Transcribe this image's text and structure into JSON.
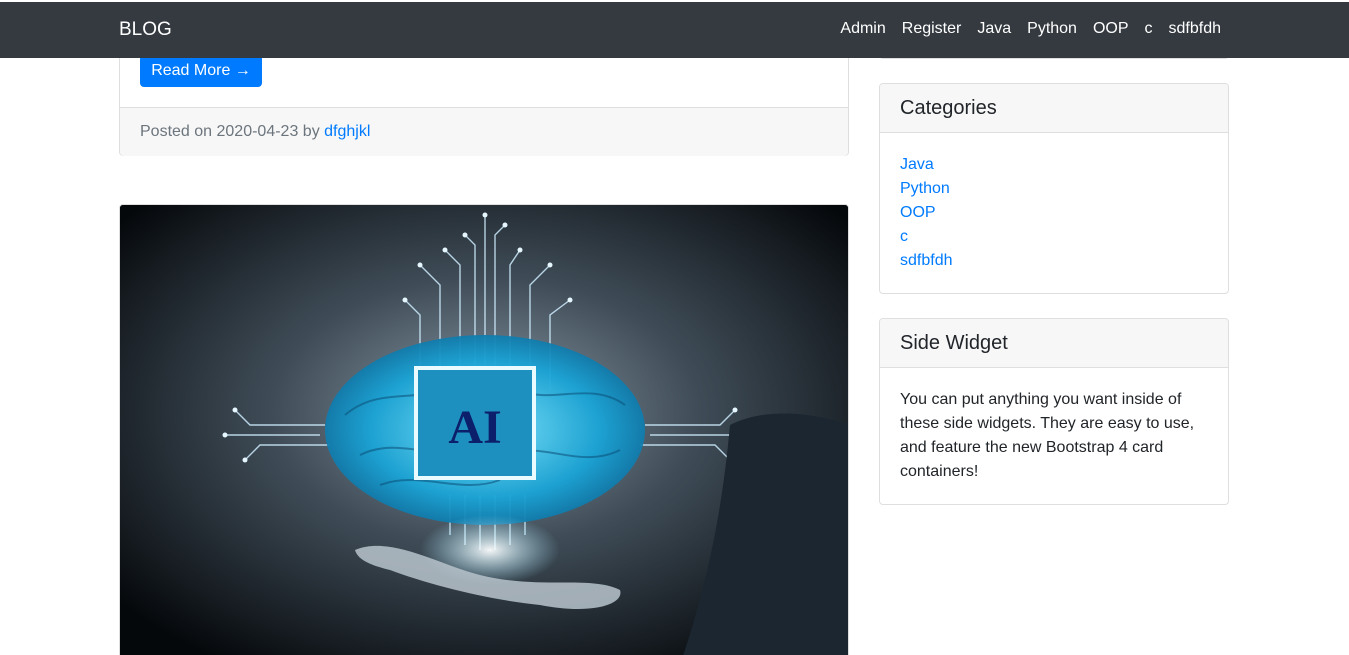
{
  "navbar": {
    "brand": "BLOG",
    "links": [
      "Admin",
      "Register",
      "Java",
      "Python",
      "OOP",
      "c",
      "sdfbfdh"
    ]
  },
  "post1": {
    "read_more_label": "Read More →",
    "posted_on_prefix": "Posted on 2020-04-23 by",
    "author": "dfghjkl"
  },
  "post2": {
    "image_text": "AI"
  },
  "categories": {
    "title": "Categories",
    "items": [
      "Java",
      "Python",
      "OOP",
      "c",
      "sdfbfdh"
    ]
  },
  "side_widget": {
    "title": "Side Widget",
    "body": "You can put anything you want inside of these side widgets. They are easy to use, and feature the new Bootstrap 4 card containers!"
  },
  "colors": {
    "navbar_bg": "#343a40",
    "primary": "#007bff",
    "card_header_bg": "#f7f7f7"
  }
}
